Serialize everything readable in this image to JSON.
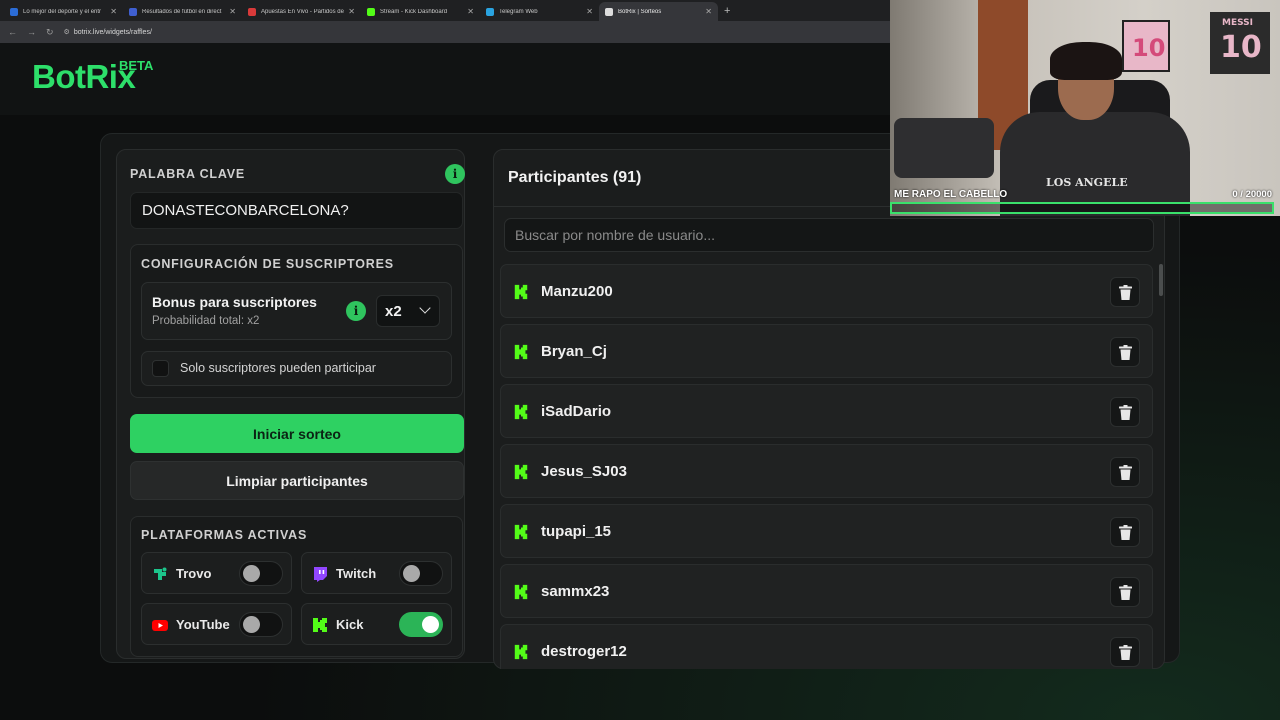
{
  "browser": {
    "tabs": [
      {
        "title": "Lo mejor del deporte y el entr",
        "color": "#2b6cd6"
      },
      {
        "title": "Resultados de fútbol en direct",
        "color": "#3f5fd0"
      },
      {
        "title": "Apuestas En Vivo - Partidos de",
        "color": "#d93a3a"
      },
      {
        "title": "Stream - Kick Dashboard",
        "color": "#53fc18"
      },
      {
        "title": "Telegram Web",
        "color": "#2aa3e0"
      },
      {
        "title": "BotRix | Sorteos",
        "color": "#dddddd"
      }
    ],
    "url": "botrix.live/widgets/raffles/"
  },
  "brand": {
    "name": "BotRix",
    "badge": "BETA",
    "accent": "#2ddf6a"
  },
  "keyword": {
    "title": "PALABRA CLAVE",
    "value": "DONASTECONBARCELONA?",
    "info": "i"
  },
  "subscribers": {
    "title": "CONFIGURACIÓN DE SUSCRIPTORES",
    "bonus_title": "Bonus para suscriptores",
    "bonus_sub": "Probabilidad total: x2",
    "info": "i",
    "multiplier": "x2",
    "only_subs_label": "Solo suscriptores pueden participar",
    "only_subs_checked": false
  },
  "actions": {
    "start": "Iniciar sorteo",
    "clear": "Limpiar participantes"
  },
  "platforms": {
    "title": "PLATAFORMAS ACTIVAS",
    "items": [
      {
        "name": "Trovo",
        "enabled": false,
        "icon": "trovo-icon"
      },
      {
        "name": "Twitch",
        "enabled": false,
        "icon": "twitch-icon"
      },
      {
        "name": "YouTube",
        "enabled": false,
        "icon": "youtube-icon"
      },
      {
        "name": "Kick",
        "enabled": true,
        "icon": "kick-icon"
      }
    ]
  },
  "participants": {
    "title": "Participantes (91)",
    "search_placeholder": "Buscar por nombre de usuario...",
    "users": [
      "Manzu200",
      "Bryan_Cj",
      "iSadDario",
      "Jesus_SJ03",
      "tupapi_15",
      "sammx23",
      "destroger12"
    ]
  },
  "webcam": {
    "goal_label": "ME RAPO EL CABELLO",
    "goal_count": "0  / 20000",
    "goal_progress": 0.0,
    "shirt_text": "LOS ANGELE",
    "jersey_left": "10",
    "jersey_right_name": "MESSI",
    "jersey_right_num": "10"
  }
}
